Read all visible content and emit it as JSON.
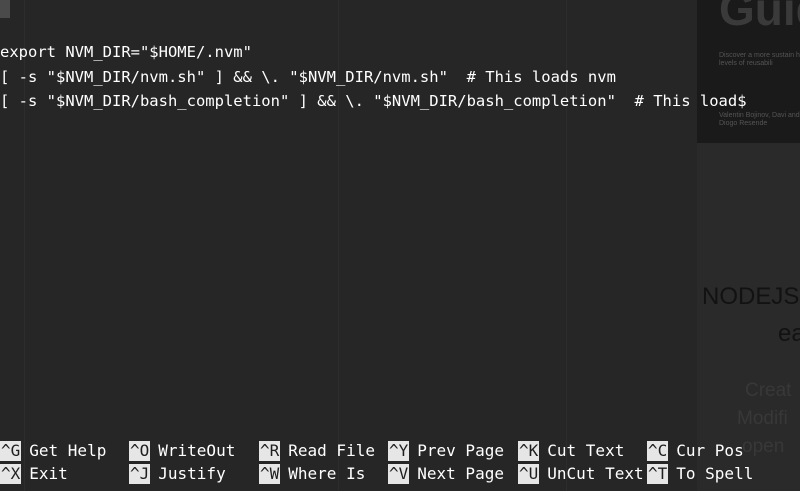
{
  "editor": {
    "lines": [
      "export NVM_DIR=\"$HOME/.nvm\"",
      "[ -s \"$NVM_DIR/nvm.sh\" ] && \\. \"$NVM_DIR/nvm.sh\"  # This loads nvm",
      "[ -s \"$NVM_DIR/bash_completion\" ] && \\. \"$NVM_DIR/bash_completion\"  # This load$"
    ]
  },
  "shortcuts": [
    {
      "key": "^G",
      "label": "Get Help"
    },
    {
      "key": "^O",
      "label": "WriteOut"
    },
    {
      "key": "^R",
      "label": "Read File"
    },
    {
      "key": "^Y",
      "label": "Prev Page"
    },
    {
      "key": "^K",
      "label": "Cut Text"
    },
    {
      "key": "^C",
      "label": "Cur Pos"
    },
    {
      "key": "^X",
      "label": "Exit"
    },
    {
      "key": "^J",
      "label": "Justify"
    },
    {
      "key": "^W",
      "label": "Where Is"
    },
    {
      "key": "^V",
      "label": "Next Page"
    },
    {
      "key": "^U",
      "label": "UnCut Text"
    },
    {
      "key": "^T",
      "label": "To Spell"
    }
  ],
  "background": {
    "book_title": "Guid",
    "book_desc": "Discover a more sustain high levels of reusabili",
    "book_authors": "Valentin Bojinov, Davi and Diogo Resende",
    "heading_1": "NODEJS",
    "heading_2": "ea",
    "items": [
      "Creat",
      "Modifi",
      "open"
    ]
  },
  "colors": {
    "terminal_bg": "#262626",
    "text": "#ffffff",
    "key_bg": "#e6e6e6"
  }
}
